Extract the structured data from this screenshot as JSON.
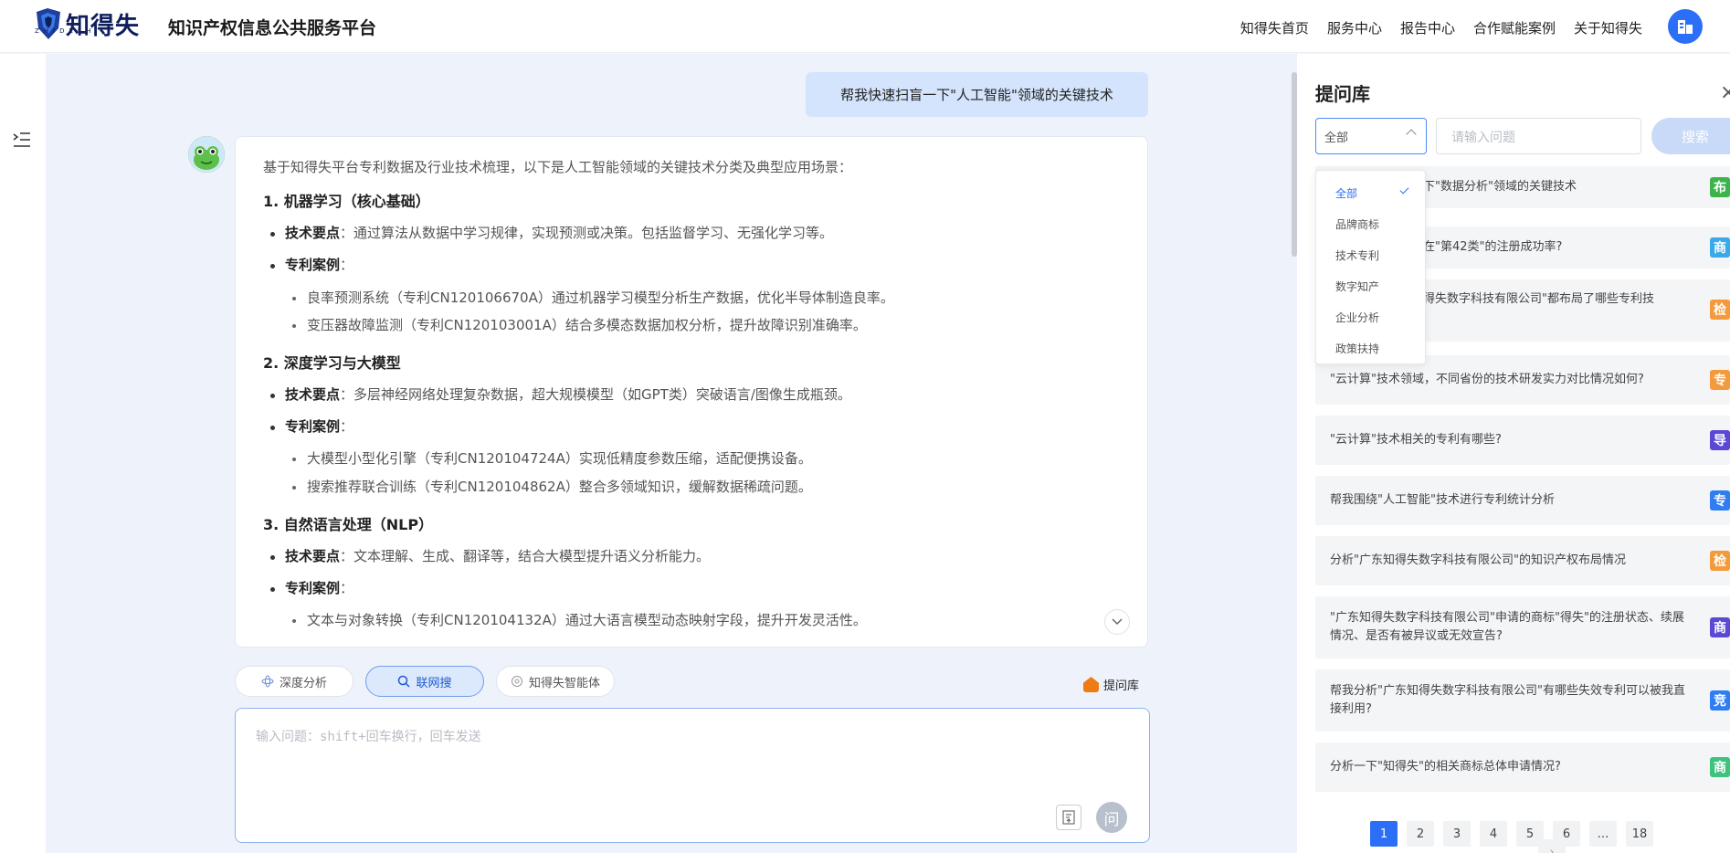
{
  "header": {
    "logo_cn": "知得失",
    "logo_en": "ZHIDESHI",
    "site_title": "知识产权信息公共服务平台",
    "nav": [
      "知得失首页",
      "服务中心",
      "报告中心",
      "合作赋能案例",
      "关于知得失"
    ]
  },
  "chat": {
    "user_message": "帮我快速扫盲一下\"人工智能\"领域的关键技术",
    "intro": "基于知得失平台专利数据及行业技术梳理，以下是人工智能领域的关键技术分类及典型应用场景：",
    "sections": [
      {
        "title": "1. 机器学习（核心基础）",
        "point_label": "技术要点",
        "point_text": "：通过算法从数据中学习规律，实现预测或决策。包括监督学习、无强化学习等。",
        "case_label": "专利案例",
        "case_colon": "：",
        "cases": [
          "良率预测系统（专利CN120106670A）通过机器学习模型分析生产数据，优化半导体制造良率。",
          "变压器故障监测（专利CN120103001A）结合多模态数据加权分析，提升故障识别准确率。"
        ]
      },
      {
        "title": "2. 深度学习与大模型",
        "point_label": "技术要点",
        "point_text": "：多层神经网络处理复杂数据，超大规模模型（如GPT类）突破语言/图像生成瓶颈。",
        "case_label": "专利案例",
        "case_colon": "：",
        "cases": [
          "大模型小型化引擎（专利CN120104724A）实现低精度参数压缩，适配便携设备。",
          "搜索推荐联合训练（专利CN120104862A）整合多领域知识，缓解数据稀疏问题。"
        ]
      },
      {
        "title": "3. 自然语言处理（NLP）",
        "point_label": "技术要点",
        "point_text": "：文本理解、生成、翻译等，结合大模型提升语义分析能力。",
        "case_label": "专利案例",
        "case_colon": "：",
        "cases": [
          "文本与对象转换（专利CN120104132A）通过大语言模型动态映射字段，提升开发灵活性。"
        ]
      }
    ]
  },
  "modes": {
    "deep": "深度分析",
    "web": "联网搜",
    "agent": "知得失智能体",
    "qlib": "提问库"
  },
  "composer": {
    "placeholder": "输入问题：shift+回车换行，回车发送",
    "send": "问"
  },
  "panel": {
    "title": "提问库",
    "close": "×",
    "select_value": "全部",
    "search_placeholder": "请输入问题",
    "search_button": "搜索",
    "dropdown": [
      {
        "label": "全部",
        "selected": true
      },
      {
        "label": "品牌商标",
        "selected": false
      },
      {
        "label": "技术专利",
        "selected": false
      },
      {
        "label": "数字知产",
        "selected": false
      },
      {
        "label": "企业分析",
        "selected": false
      },
      {
        "label": "政策扶持",
        "selected": false
      }
    ],
    "questions": [
      {
        "text": "下\"数据分析\"领域的关键技术",
        "tag": "布",
        "color": "#3cb44b"
      },
      {
        "text": "在\"第42类\"的注册成功率?",
        "tag": "商",
        "color": "#39a9e8"
      },
      {
        "text": "得失数字科技有限公司\"都布局了哪些专利技",
        "tag": "检",
        "color": "#f39a3c"
      },
      {
        "text": "\"云计算\"技术领域，不同省份的技术研发实力对比情况如何?",
        "tag": "专",
        "color": "#f39a3c"
      },
      {
        "text": "\"云计算\"技术相关的专利有哪些?",
        "tag": "导",
        "color": "#5a49d6"
      },
      {
        "text": "帮我围绕\"人工智能\"技术进行专利统计分析",
        "tag": "专",
        "color": "#2f7df0"
      },
      {
        "text": "分析\"广东知得失数字科技有限公司\"的知识产权布局情况",
        "tag": "检",
        "color": "#f39a3c"
      },
      {
        "text": "\"广东知得失数字科技有限公司\"申请的商标\"得失\"的注册状态、续展情况、是否有被异议或无效宣告?",
        "tag": "商",
        "color": "#5a49d6"
      },
      {
        "text": "帮我分析\"广东知得失数字科技有限公司\"有哪些失效专利可以被我直接利用?",
        "tag": "竞",
        "color": "#2f7df0"
      },
      {
        "text": "分析一下\"知得失\"的相关商标总体申请情况?",
        "tag": "商",
        "color": "#3ec27e"
      }
    ],
    "pager": {
      "prev": "‹",
      "pages": [
        "1",
        "2",
        "3",
        "4",
        "5",
        "6",
        "…",
        "18"
      ],
      "current": "1",
      "next": "›"
    }
  }
}
